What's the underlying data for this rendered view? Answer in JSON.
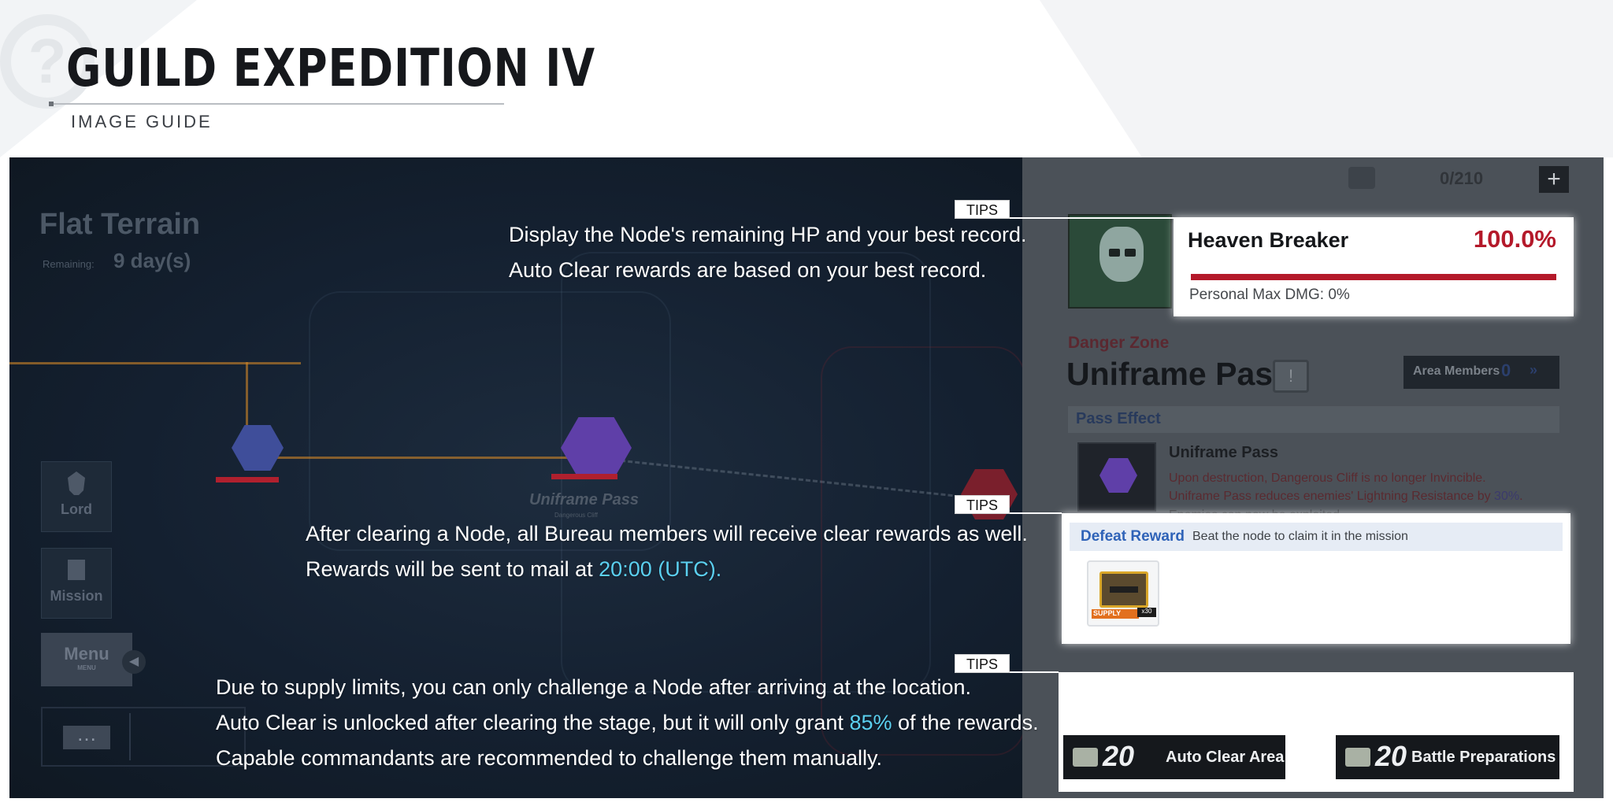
{
  "header": {
    "title": "GUILD EXPEDITION IV",
    "subtitle": "IMAGE GUIDE"
  },
  "game": {
    "terrain": {
      "title": "Flat Terrain",
      "remaining_label": "Remaining:",
      "remaining_value": "9 day(s)"
    },
    "map": {
      "node_label": "Uniframe Pass",
      "node_sublabel": "Dangerous Cliff"
    },
    "side_buttons": {
      "lord": "Lord",
      "mission": "Mission",
      "menu": "Menu",
      "menu_sub": "MENU",
      "chat_icon": "…"
    },
    "resource": {
      "count": "0/210",
      "plus": "+"
    },
    "boss": {
      "name": "Heaven Breaker",
      "hp_percent": "100.0%",
      "hp_fraction": 1.0,
      "personal_max_label": "Personal Max DMG: 0%"
    },
    "zone": {
      "danger_label": "Danger Zone",
      "name": "Uniframe Pass",
      "area_members_label": "Area Members",
      "area_members_count": "0",
      "pass_effect_label": "Pass Effect",
      "pass_title": "Uniframe Pass",
      "pass_desc_1": "Upon destruction, Dangerous Cliff is no longer Invincible.",
      "pass_desc_2a": "Uniframe Pass reduces enemies' Lightning Resistance by ",
      "pass_desc_2b": "30%",
      "pass_desc_2c": ".",
      "pass_desc_cut": "Enemies can now be exploited"
    },
    "reward": {
      "label": "Defeat Reward",
      "desc": "Beat the node to claim it in the mission",
      "item_tag": "SUPPLY",
      "item_qty": "x30"
    },
    "actions": {
      "auto_clear_cost": "20",
      "auto_clear_label": "Auto Clear Area",
      "battle_cost": "20",
      "battle_label": "Battle Preparations"
    }
  },
  "tips": {
    "tag": "TIPS",
    "tip1": {
      "line1": "Display the Node's remaining HP and your best record.",
      "line2": "Auto Clear rewards are based on your best record."
    },
    "tip2": {
      "line1": "After clearing a Node, all Bureau members will receive clear rewards as well.",
      "line2a": "Rewards will be sent to mail at ",
      "line2b": "20:00 (UTC)."
    },
    "tip3": {
      "line1": "Due to supply limits, you can only challenge a Node after arriving at the location.",
      "line2a": "Auto Clear is unlocked after clearing the stage, but it will only grant ",
      "line2b": "85%",
      "line2c": " of the rewards.",
      "line3": "Capable commandants are recommended to challenge them manually."
    }
  },
  "colors": {
    "accent_red": "#b4192a",
    "highlight_cyan": "#5bd0f0",
    "reward_blue": "#2f63b8"
  }
}
